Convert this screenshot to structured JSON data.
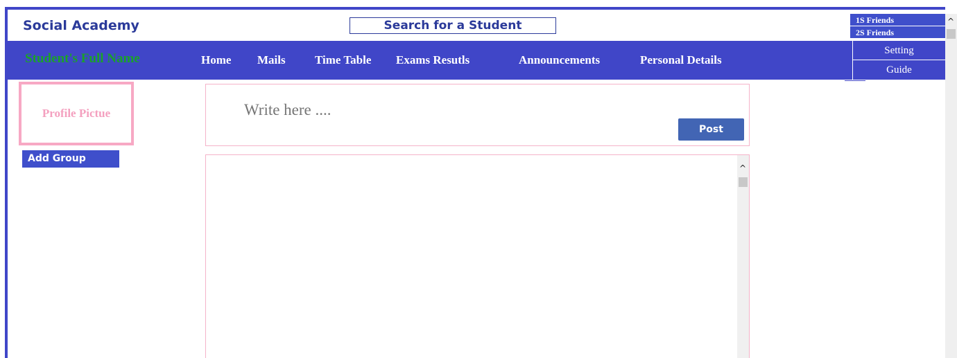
{
  "header": {
    "brand": "Social Academy",
    "search_label": "Search for a Student",
    "friends": [
      "1S Friends",
      "2S Friends"
    ]
  },
  "nav": {
    "student_name": "Student's Full Name",
    "items": [
      "Home",
      "Mails",
      "Time Table",
      "Exams Resutls",
      "Announcements",
      "Personal Details"
    ],
    "side_menu": [
      "Setting",
      "Guide"
    ]
  },
  "profile": {
    "picture_label": "Profile Pictue",
    "add_group_label": "Add Group"
  },
  "composer": {
    "placeholder": "Write here ....",
    "post_label": "Post"
  },
  "colors": {
    "primary": "#4046c8",
    "accent_pink": "#f7a8c4",
    "name_green": "#1aa12a",
    "post_button": "#4265b4"
  },
  "icons": {
    "scroll_up": "chevron-up-icon"
  }
}
